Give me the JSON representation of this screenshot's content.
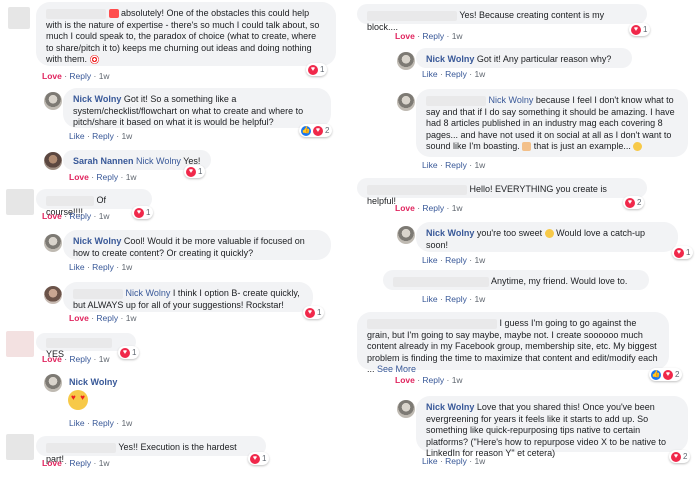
{
  "actions": {
    "love": "Love",
    "like": "Like",
    "reply": "Reply",
    "dot": "·"
  },
  "left": [
    {
      "author": "",
      "text": " absolutely! One of the obstacles this could help with is the nature of expertise - there's so much I could talk about, so much I could speak to, the paradox of choice (what to create, where to share/pitch it to) keeps me churning out ideas and doing nothing with them. ",
      "first_action": "Love",
      "time": "1w",
      "reactions": "1"
    },
    {
      "author": "Nick Wolny",
      "text": "Got it! So a something like a system/checklist/flowchart on what to create and where to pitch/share it based on what it is would be helpful?",
      "first_action": "Like",
      "time": "1w",
      "reactions": "2"
    },
    {
      "author": "Sarah Nannen",
      "mention": "Nick Wolny",
      "text": "Yes!",
      "first_action": "Love",
      "time": "1w",
      "reactions": "1"
    },
    {
      "author": "",
      "text": "Of course!!!!",
      "first_action": "Love",
      "time": "1w",
      "reactions": "1"
    },
    {
      "author": "Nick Wolny",
      "text": "Cool! Would it be more valuable if focused on how to create content? Or creating it quickly?",
      "first_action": "Like",
      "time": "1w",
      "reactions": ""
    },
    {
      "author": "",
      "mention": "Nick Wolny",
      "text": "I think I option B- create quickly, but ALWAYS up for all of your suggestions! Rockstar!",
      "first_action": "Love",
      "time": "1w",
      "reactions": "1"
    },
    {
      "author": "",
      "text": "YES",
      "first_action": "Love",
      "time": "1w",
      "reactions": "1"
    },
    {
      "author": "Nick Wolny",
      "text": "",
      "first_action": "Like",
      "time": "1w",
      "reactions": ""
    },
    {
      "author": "",
      "text": "Yes!! Execution is the hardest part!",
      "first_action": "Love",
      "time": "1w",
      "reactions": "1"
    }
  ],
  "right": [
    {
      "author": "",
      "text": "Yes! Because creating content is my block....",
      "first_action": "Love",
      "time": "1w",
      "reactions": "1"
    },
    {
      "author": "Nick Wolny",
      "text": "Got it! Any particular reason why?",
      "first_action": "Like",
      "time": "1w",
      "reactions": ""
    },
    {
      "author": "",
      "mention": "Nick Wolny",
      "text": "because I feel I don't know what to say and that if I do say something it should be amazing. I have had 8 articles published in an industry mag each covering 8 pages... and have not used it on social at all as I don't want to sound like I'm boasting. ",
      "text2": " that is just an example... ",
      "first_action": "Like",
      "time": "1w",
      "reactions": ""
    },
    {
      "author": "",
      "text": "Hello! EVERYTHING you create is helpful!",
      "first_action": "Love",
      "time": "1w",
      "reactions": "2"
    },
    {
      "author": "Nick Wolny",
      "text": "you're too sweet ",
      "text2": " Would love a catch-up soon!",
      "first_action": "Like",
      "time": "1w",
      "reactions": "1"
    },
    {
      "author": "",
      "text": "Anytime, my friend. Would love to.",
      "first_action": "Like",
      "time": "1w",
      "reactions": ""
    },
    {
      "author": "",
      "text": "I guess I'm going to go against the grain, but I'm going to say maybe, maybe not. I create soooooo much content already in my Facebook group, membership site, etc. My biggest problem is finding the time to maximize that content and edit/modify each ... ",
      "see_more": "See More",
      "first_action": "Love",
      "time": "1w",
      "reactions": "2"
    },
    {
      "author": "Nick Wolny",
      "text": "Love that you shared this! Once you've been evergreening for years it feels like it starts to add up. So something like quick-repurposing tips native to certain platforms? (\"Here's how to repurpose video X to be native to LinkedIn for reason Y\" et cetera)",
      "first_action": "Like",
      "time": "1w",
      "reactions": "2"
    }
  ]
}
